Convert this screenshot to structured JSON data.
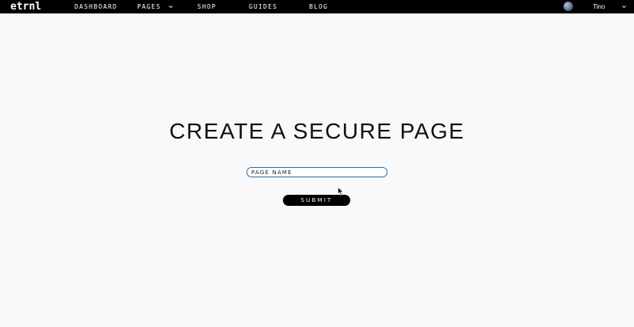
{
  "header": {
    "logo": "etrnl",
    "nav": [
      {
        "label": "DASHBOARD"
      },
      {
        "label": "PAGES",
        "has_dropdown": true
      },
      {
        "label": "SHOP"
      },
      {
        "label": "GUIDES"
      },
      {
        "label": "BLOG"
      }
    ],
    "user": {
      "name": "Tino"
    }
  },
  "main": {
    "title": "CREATE A SECURE PAGE",
    "input_placeholder": "PAGE NAME",
    "input_value": "",
    "submit_label": "SUBMIT"
  },
  "colors": {
    "background": "#f9f8fb",
    "topbar": "#000000",
    "input_border": "#2a6fb3",
    "button": "#000000"
  },
  "icons": [
    "chevron-down-icon",
    "avatar",
    "mouse-cursor-icon"
  ]
}
